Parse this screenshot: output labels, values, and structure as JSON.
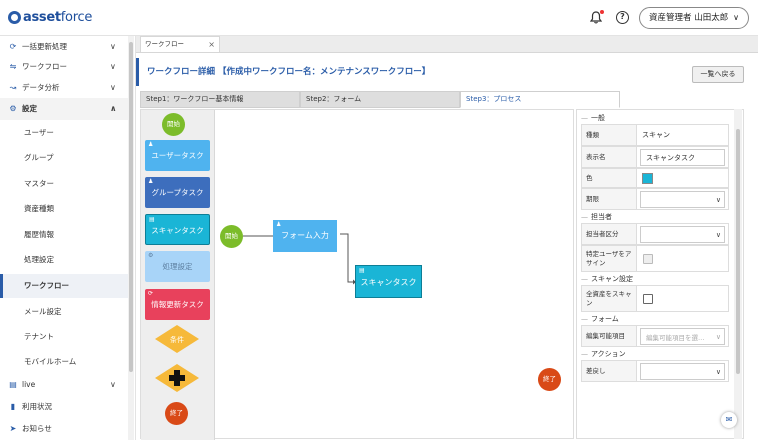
{
  "header": {
    "logo_bold": "asset",
    "logo_regular": "force",
    "user_label": "資産管理者 山田太郎"
  },
  "sidebar": {
    "items": [
      {
        "label": "一括更新処理",
        "icon": "refresh-icon"
      },
      {
        "label": "ワークフロー",
        "icon": "workflow-icon"
      },
      {
        "label": "データ分析",
        "icon": "chart-line-icon"
      },
      {
        "label": "設定",
        "icon": "gear-icon"
      }
    ],
    "sub_items": [
      "ユーザー",
      "グループ",
      "マスター",
      "資産種類",
      "履歴情報",
      "処理設定",
      "ワークフロー",
      "メール設定",
      "テナント",
      "モバイルホーム"
    ],
    "bottom_items": [
      {
        "label": "live",
        "icon": "live-icon"
      },
      {
        "label": "利用状況",
        "icon": "bar-chart-icon"
      },
      {
        "label": "お知らせ",
        "icon": "megaphone-icon"
      }
    ]
  },
  "main": {
    "window_tab": "ワークフロー",
    "title": "ワークフロー詳細 【作成中ワークフロー名：メンテナンスワークフロー】",
    "back_button": "一覧へ戻る",
    "steps": [
      "Step1：ワークフロー基本情報",
      "Step2：フォーム",
      "Step3：プロセス"
    ]
  },
  "palette": {
    "start": "開始",
    "user_task": "ユーザータスク",
    "group_task": "グループタスク",
    "scan_task": "スキャンタスク",
    "process_setting": "処理設定",
    "info_update_task": "情報更新タスク",
    "condition": "条件",
    "end": "終了"
  },
  "diagram": {
    "start": "開始",
    "form_input": "フォーム入力",
    "scan_task": "スキャンタスク",
    "end": "終了"
  },
  "props": {
    "general_title": "一般",
    "type_label": "種類",
    "type_value": "スキャン",
    "display_name_label": "表示名",
    "display_name_value": "スキャンタスク",
    "color_label": "色",
    "color_value": "#1ab5d6",
    "deadline_label": "期限",
    "assignee_title": "担当者",
    "assignee_type_label": "担当者区分",
    "specific_user_label": "特定ユーザをアサイン",
    "scan_title": "スキャン設定",
    "scan_all_label": "全資産をスキャン",
    "form_title": "フォーム",
    "editable_items_label": "編集可能項目",
    "editable_items_placeholder": "編集可能項目を選…",
    "action_title": "アクション",
    "sendback_label": "差戻し"
  },
  "colors": {
    "brand": "#2a5ca8",
    "start": "#7cbc2a",
    "end": "#d94a17",
    "user_task": "#4fb3ef",
    "group_task": "#3d6ebd",
    "scan_task": "#1ab5d6",
    "process_setting": "#a8d4f8",
    "info_update_task": "#e8415c",
    "condition": "#f6b93a"
  }
}
